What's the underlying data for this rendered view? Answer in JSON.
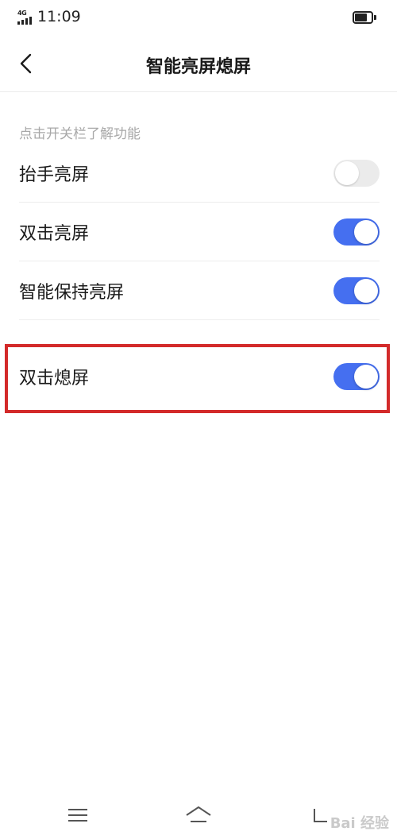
{
  "status_bar": {
    "network": "4G",
    "time": "11:09",
    "battery_level": 0.75
  },
  "header": {
    "title": "智能亮屏熄屏",
    "back_icon": "chevron-left-icon"
  },
  "section_hint": "点击开关栏了解功能",
  "settings": [
    {
      "label": "抬手亮屏",
      "enabled": false
    },
    {
      "label": "双击亮屏",
      "enabled": true
    },
    {
      "label": "智能保持亮屏",
      "enabled": true
    },
    {
      "label": "双击熄屏",
      "enabled": true
    }
  ],
  "colors": {
    "toggle_on": "#456ff0",
    "toggle_off": "#ebebeb",
    "highlight": "#d32a2a",
    "hint_text": "#a8a8a8"
  },
  "bottom_nav": {
    "icons": [
      "menu-icon",
      "home-icon",
      "back-icon"
    ]
  },
  "watermark": "Bai 经验"
}
